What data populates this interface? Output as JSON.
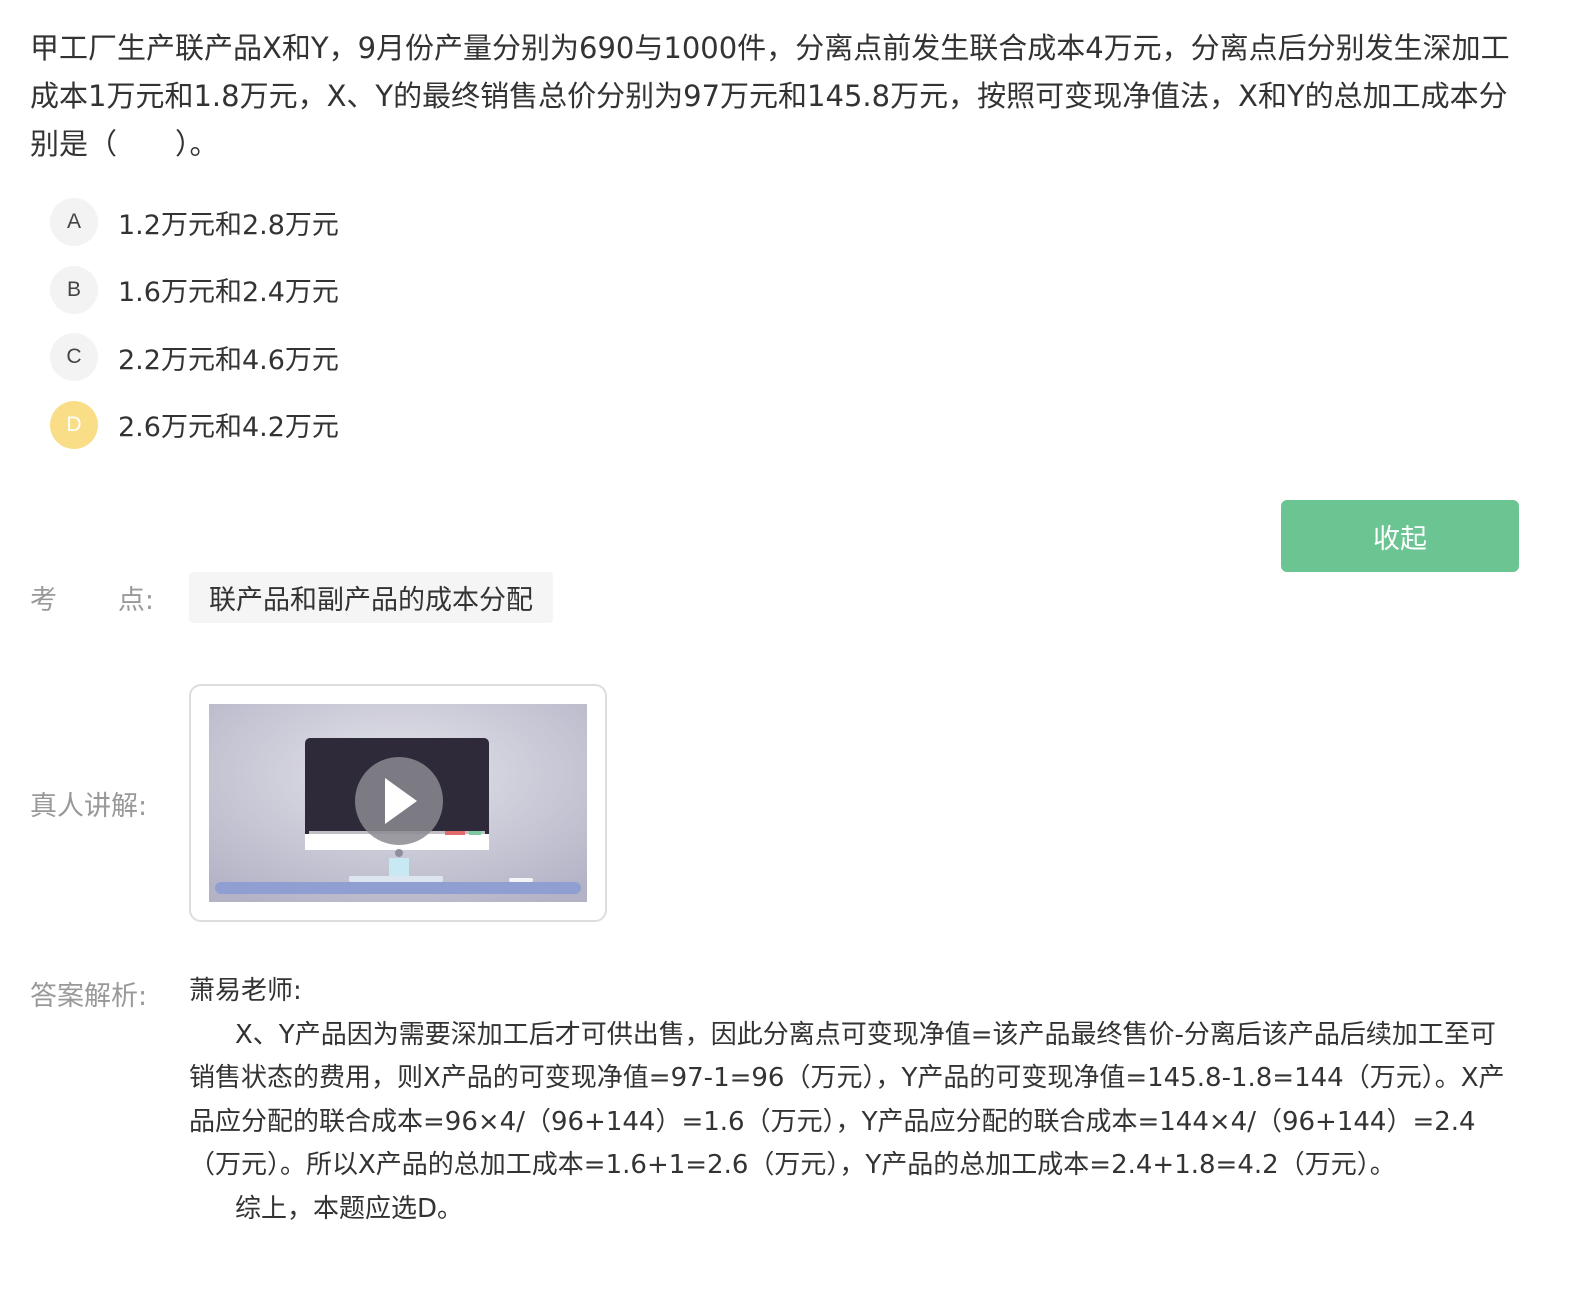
{
  "question": {
    "text": "甲工厂生产联产品X和Y，9月份产量分别为690与1000件，分离点前发生联合成本4万元，分离点后分别发生深加工成本1万元和1.8万元，X、Y的最终销售总价分别为97万元和145.8万元，按照可变现净值法，X和Y的总加工成本分别是（　　）。"
  },
  "options": [
    {
      "letter": "A",
      "text": "1.2万元和2.8万元"
    },
    {
      "letter": "B",
      "text": "1.6万元和2.4万元"
    },
    {
      "letter": "C",
      "text": "2.2万元和4.6万元"
    },
    {
      "letter": "D",
      "text": "2.6万元和4.2万元"
    }
  ],
  "selected_option": "D",
  "collapse_button": "收起",
  "kaodian": {
    "label_first": "考",
    "label_second": "点:",
    "tag": "联产品和副产品的成本分配"
  },
  "video": {
    "label": "真人讲解:",
    "icon": "play-icon"
  },
  "analysis": {
    "label": "答案解析:",
    "teacher": "萧易老师:",
    "body": "X、Y产品因为需要深加工后才可供出售，因此分离点可变现净值=该产品最终售价-分离后该产品后续加工至可销售状态的费用，则X产品的可变现净值=97-1=96（万元），Y产品的可变现净值=145.8-1.8=144（万元）。X产品应分配的联合成本=96×4/（96+144）=1.6（万元），Y产品应分配的联合成本=144×4/（96+144）=2.4（万元）。所以X产品的总加工成本=1.6+1=2.6（万元），Y产品的总加工成本=2.4+1.8=4.2（万元）。",
    "conclusion": "综上，本题应选D。"
  },
  "colors": {
    "accent_green": "#6bc593",
    "selected_yellow": "#f9dd87",
    "label_gray": "#999999"
  }
}
